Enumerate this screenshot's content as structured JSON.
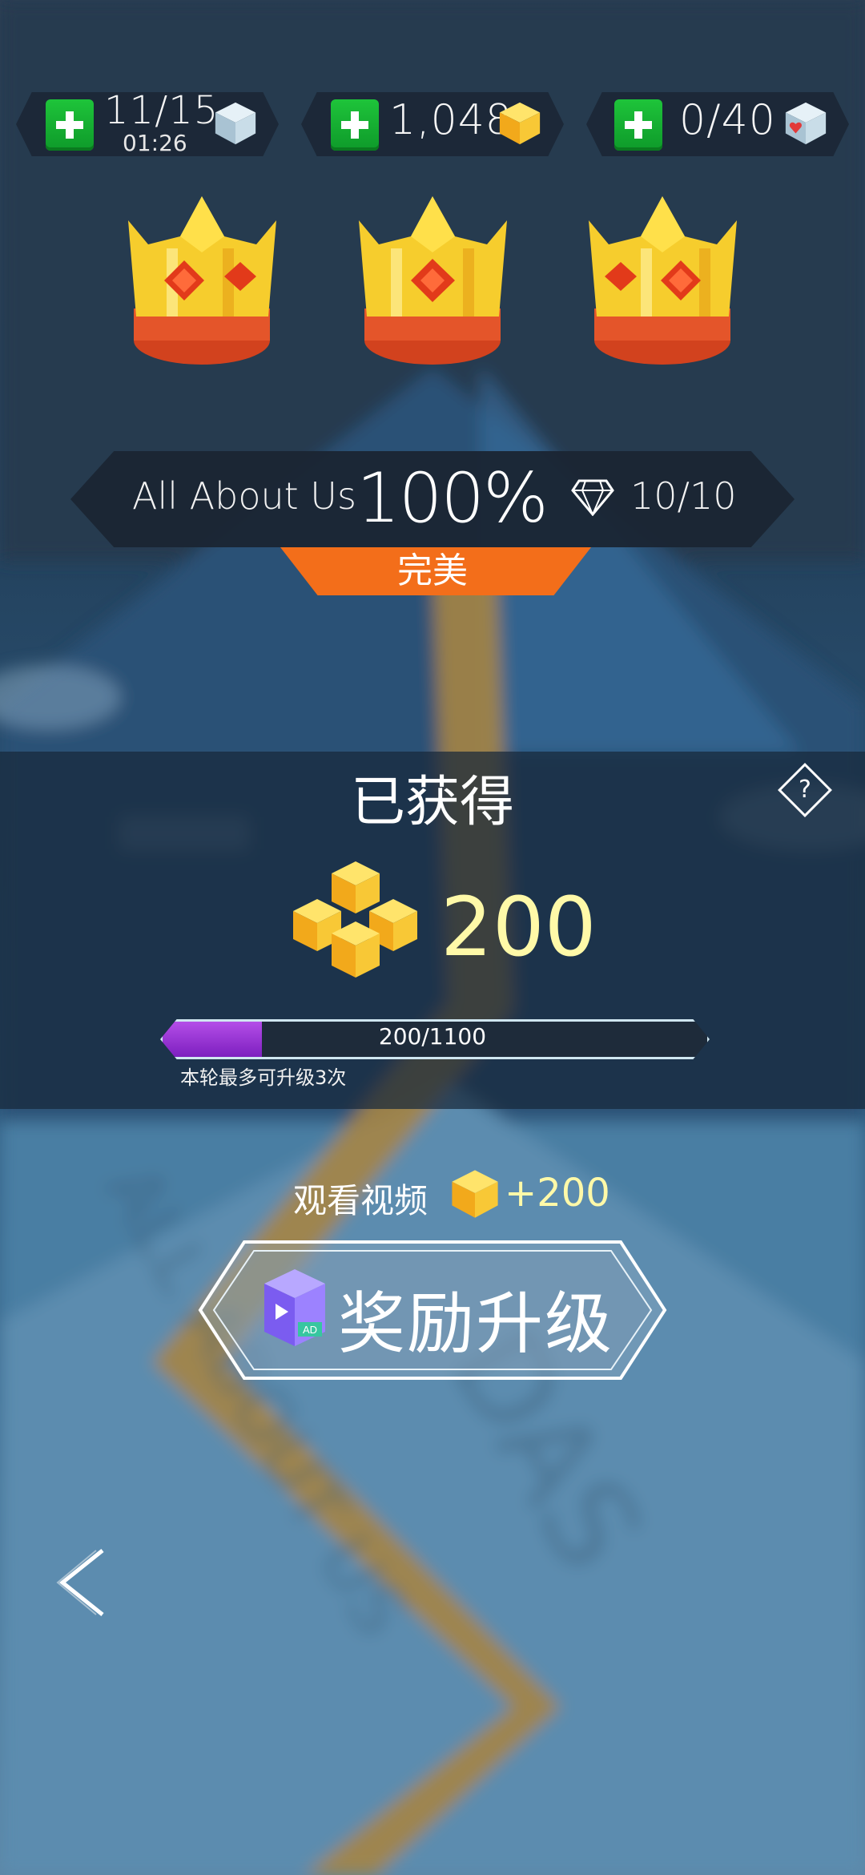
{
  "resources": {
    "stamina": {
      "value": "11/15",
      "timer": "01:26"
    },
    "gems_coins": {
      "value": "1,048"
    },
    "hearts": {
      "value": "0/40"
    }
  },
  "level": {
    "song": "All About Us",
    "percent": "100%",
    "diamonds": "10/10",
    "rating": "完美",
    "crowns": 3
  },
  "earned": {
    "title": "已获得",
    "help": "?",
    "amount": "200",
    "progress_text": "200/1100",
    "progress_fraction": 0.182,
    "note": "本轮最多可升级3次"
  },
  "video": {
    "label": "观看视频",
    "bonus": "+200",
    "button_label": "奖励升级",
    "ad_tag": "AD"
  },
  "colors": {
    "accent_orange": "#f36e1a",
    "plus_green": "#1ec43a",
    "gold": "#f5c21f",
    "progress_purple": "#a33be0",
    "amount_yellow": "#fff9a8"
  },
  "icons": [
    "plus-icon",
    "cube-icon",
    "gold-gem-icon",
    "heart-cube-icon",
    "crown-icon",
    "diamond-icon",
    "help-icon",
    "coin-stack-icon",
    "ad-icon",
    "back-arrow-icon"
  ]
}
